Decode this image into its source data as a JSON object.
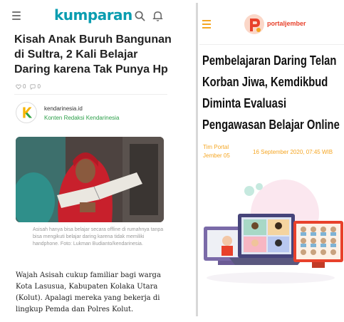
{
  "left": {
    "brand": "kumparan",
    "title": "Kisah Anak Buruh Bangunan di Sultra, 2 Kali Belajar Daring karena Tak Punya Hp",
    "likes": "0",
    "comments": "0",
    "author": {
      "name": "kendarinesia.id",
      "subtitle": "Konten Redaksi Kendarinesia"
    },
    "caption": "Asisah hanya bisa belajar secara offline di rumahnya tanpa bisa mengikuti belajar daring karena tidak memiliki handphone. Foto: Lukman Budianto/kendarinesia.",
    "body": "Wajah Asisah cukup familiar bagi warga Kota Lasusua, Kabupaten Kolaka Utara (Kolut). Apalagi mereka yang bekerja di lingkup Pemda dan Polres Kolut.",
    "icons": [
      "menu-icon",
      "search-icon",
      "bell-icon",
      "heart-icon",
      "comment-icon"
    ]
  },
  "right": {
    "brand": "portaljember",
    "title": "Pembelajaran Daring Telan Korban Jiwa, Kemdikbud Diminta Evaluasi Pengawasan Belajar Online",
    "author_line1": "Tim Portal",
    "author_line2": "Jember 05",
    "date": "16 September 2020, 07:45 WIB",
    "icons": [
      "menu-icon"
    ]
  },
  "colors": {
    "kumparan_accent": "#0a9db0",
    "portal_orange": "#f5a623",
    "portal_red": "#e8412b",
    "author_green": "#2ea04b"
  }
}
